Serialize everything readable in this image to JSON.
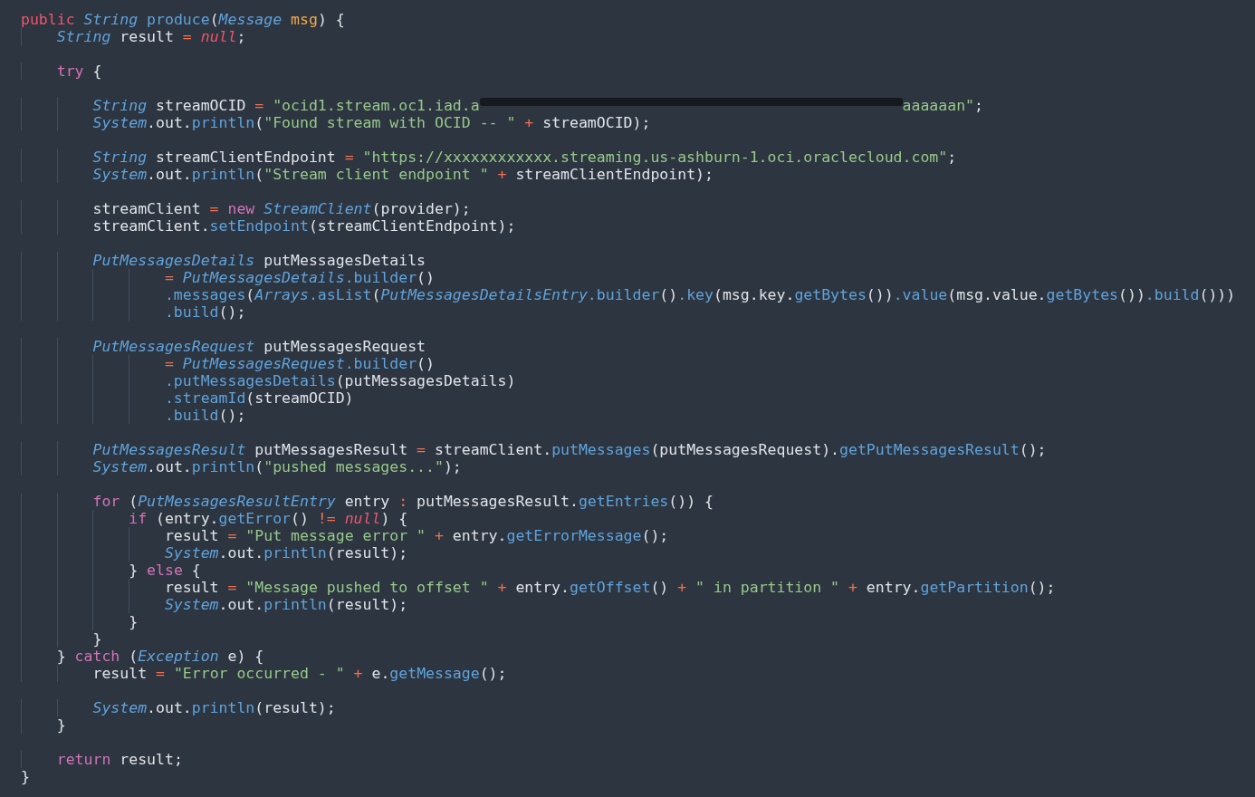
{
  "editor": {
    "lines": [
      {
        "kind": "code",
        "tokens": [
          {
            "kind": "modifier",
            "text": "public "
          },
          {
            "kind": "type",
            "text": "String "
          },
          {
            "kind": "fn",
            "text": "produce"
          },
          {
            "kind": "plain",
            "text": "("
          },
          {
            "kind": "type",
            "text": "Message "
          },
          {
            "kind": "param",
            "text": "msg"
          },
          {
            "kind": "plain",
            "text": ") {"
          }
        ]
      },
      {
        "kind": "code",
        "tokens": [
          {
            "kind": "type",
            "text": "    String"
          },
          {
            "kind": "plain",
            "text": " result "
          },
          {
            "kind": "op",
            "text": "= "
          },
          {
            "kind": "literal",
            "text": "null"
          },
          {
            "kind": "plain",
            "text": ";"
          }
        ]
      },
      {
        "kind": "blank"
      },
      {
        "kind": "code",
        "tokens": [
          {
            "kind": "keyword",
            "text": "    try"
          },
          {
            "kind": "plain",
            "text": " {"
          }
        ]
      },
      {
        "kind": "blank"
      },
      {
        "kind": "code",
        "tokens": [
          {
            "kind": "type",
            "text": "        String"
          },
          {
            "kind": "plain",
            "text": " streamOCID "
          },
          {
            "kind": "op",
            "text": "= "
          },
          {
            "kind": "str",
            "text": "\"ocid1.stream.oc1.iad.a"
          },
          {
            "kind": "redacted"
          },
          {
            "kind": "str",
            "text": "aaaaaan\""
          },
          {
            "kind": "plain",
            "text": ";"
          }
        ]
      },
      {
        "kind": "code",
        "tokens": [
          {
            "kind": "type",
            "text": "        System"
          },
          {
            "kind": "plain",
            "text": ".out."
          },
          {
            "kind": "fn",
            "text": "println"
          },
          {
            "kind": "plain",
            "text": "("
          },
          {
            "kind": "str",
            "text": "\"Found stream with OCID -- \" "
          },
          {
            "kind": "op",
            "text": "+"
          },
          {
            "kind": "plain",
            "text": " streamOCID);"
          }
        ]
      },
      {
        "kind": "blank"
      },
      {
        "kind": "code",
        "tokens": [
          {
            "kind": "type",
            "text": "        String"
          },
          {
            "kind": "plain",
            "text": " streamClientEndpoint "
          },
          {
            "kind": "op",
            "text": "= "
          },
          {
            "kind": "str",
            "text": "\"https://xxxxxxxxxxxx.streaming.us-ashburn-1.oci.oraclecloud.com\""
          },
          {
            "kind": "plain",
            "text": ";"
          }
        ]
      },
      {
        "kind": "code",
        "tokens": [
          {
            "kind": "type",
            "text": "        System"
          },
          {
            "kind": "plain",
            "text": ".out."
          },
          {
            "kind": "fn",
            "text": "println"
          },
          {
            "kind": "plain",
            "text": "("
          },
          {
            "kind": "str",
            "text": "\"Stream client endpoint \" "
          },
          {
            "kind": "op",
            "text": "+"
          },
          {
            "kind": "plain",
            "text": " streamClientEndpoint);"
          }
        ]
      },
      {
        "kind": "blank"
      },
      {
        "kind": "code",
        "tokens": [
          {
            "kind": "plain",
            "text": "        streamClient "
          },
          {
            "kind": "op",
            "text": "= "
          },
          {
            "kind": "keyword",
            "text": "new "
          },
          {
            "kind": "type",
            "text": "StreamClient"
          },
          {
            "kind": "plain",
            "text": "(provider);"
          }
        ]
      },
      {
        "kind": "code",
        "tokens": [
          {
            "kind": "plain",
            "text": "        streamClient."
          },
          {
            "kind": "fn",
            "text": "setEndpoint"
          },
          {
            "kind": "plain",
            "text": "(streamClientEndpoint);"
          }
        ]
      },
      {
        "kind": "blank"
      },
      {
        "kind": "code",
        "tokens": [
          {
            "kind": "type",
            "text": "        PutMessagesDetails"
          },
          {
            "kind": "plain",
            "text": " putMessagesDetails"
          }
        ]
      },
      {
        "kind": "code",
        "tokens": [
          {
            "kind": "op",
            "text": "                = "
          },
          {
            "kind": "type",
            "text": "PutMessagesDetails"
          },
          {
            "kind": "fn",
            "text": ".builder"
          },
          {
            "kind": "plain",
            "text": "()"
          }
        ]
      },
      {
        "kind": "code",
        "tokens": [
          {
            "kind": "fn",
            "text": "                .messages"
          },
          {
            "kind": "plain",
            "text": "("
          },
          {
            "kind": "type",
            "text": "Arrays"
          },
          {
            "kind": "fn",
            "text": ".asList"
          },
          {
            "kind": "plain",
            "text": "("
          },
          {
            "kind": "type",
            "text": "PutMessagesDetailsEntry"
          },
          {
            "kind": "fn",
            "text": ".builder"
          },
          {
            "kind": "plain",
            "text": "()"
          },
          {
            "kind": "fn",
            "text": ".key"
          },
          {
            "kind": "plain",
            "text": "(msg.key."
          },
          {
            "kind": "fn",
            "text": "getBytes"
          },
          {
            "kind": "plain",
            "text": "())"
          },
          {
            "kind": "fn",
            "text": ".value"
          },
          {
            "kind": "plain",
            "text": "(msg.value."
          },
          {
            "kind": "fn",
            "text": "getBytes"
          },
          {
            "kind": "plain",
            "text": "())"
          },
          {
            "kind": "fn",
            "text": ".build"
          },
          {
            "kind": "plain",
            "text": "()))"
          }
        ]
      },
      {
        "kind": "code",
        "tokens": [
          {
            "kind": "fn",
            "text": "                .build"
          },
          {
            "kind": "plain",
            "text": "();"
          }
        ]
      },
      {
        "kind": "blank"
      },
      {
        "kind": "code",
        "tokens": [
          {
            "kind": "type",
            "text": "        PutMessagesRequest"
          },
          {
            "kind": "plain",
            "text": " putMessagesRequest"
          }
        ]
      },
      {
        "kind": "code",
        "tokens": [
          {
            "kind": "op",
            "text": "                = "
          },
          {
            "kind": "type",
            "text": "PutMessagesRequest"
          },
          {
            "kind": "fn",
            "text": ".builder"
          },
          {
            "kind": "plain",
            "text": "()"
          }
        ]
      },
      {
        "kind": "code",
        "tokens": [
          {
            "kind": "fn",
            "text": "                .putMessagesDetails"
          },
          {
            "kind": "plain",
            "text": "(putMessagesDetails)"
          }
        ]
      },
      {
        "kind": "code",
        "tokens": [
          {
            "kind": "fn",
            "text": "                .streamId"
          },
          {
            "kind": "plain",
            "text": "(streamOCID)"
          }
        ]
      },
      {
        "kind": "code",
        "tokens": [
          {
            "kind": "fn",
            "text": "                .build"
          },
          {
            "kind": "plain",
            "text": "();"
          }
        ]
      },
      {
        "kind": "blank"
      },
      {
        "kind": "code",
        "tokens": [
          {
            "kind": "type",
            "text": "        PutMessagesResult"
          },
          {
            "kind": "plain",
            "text": " putMessagesResult "
          },
          {
            "kind": "op",
            "text": "="
          },
          {
            "kind": "plain",
            "text": " streamClient."
          },
          {
            "kind": "fn",
            "text": "putMessages"
          },
          {
            "kind": "plain",
            "text": "(putMessagesRequest)."
          },
          {
            "kind": "fn",
            "text": "getPutMessagesResult"
          },
          {
            "kind": "plain",
            "text": "();"
          }
        ]
      },
      {
        "kind": "code",
        "tokens": [
          {
            "kind": "type",
            "text": "        System"
          },
          {
            "kind": "plain",
            "text": ".out."
          },
          {
            "kind": "fn",
            "text": "println"
          },
          {
            "kind": "plain",
            "text": "("
          },
          {
            "kind": "str",
            "text": "\"pushed messages...\""
          },
          {
            "kind": "plain",
            "text": ");"
          }
        ]
      },
      {
        "kind": "blank"
      },
      {
        "kind": "code",
        "tokens": [
          {
            "kind": "keyword",
            "text": "        for"
          },
          {
            "kind": "plain",
            "text": " ("
          },
          {
            "kind": "type",
            "text": "PutMessagesResultEntry"
          },
          {
            "kind": "plain",
            "text": " entry "
          },
          {
            "kind": "op",
            "text": ":"
          },
          {
            "kind": "plain",
            "text": " putMessagesResult."
          },
          {
            "kind": "fn",
            "text": "getEntries"
          },
          {
            "kind": "plain",
            "text": "()) {"
          }
        ]
      },
      {
        "kind": "code",
        "tokens": [
          {
            "kind": "keyword",
            "text": "            if"
          },
          {
            "kind": "plain",
            "text": " (entry."
          },
          {
            "kind": "fn",
            "text": "getError"
          },
          {
            "kind": "plain",
            "text": "() "
          },
          {
            "kind": "op",
            "text": "!= "
          },
          {
            "kind": "literal",
            "text": "null"
          },
          {
            "kind": "plain",
            "text": ") {"
          }
        ]
      },
      {
        "kind": "code",
        "tokens": [
          {
            "kind": "plain",
            "text": "                result "
          },
          {
            "kind": "op",
            "text": "= "
          },
          {
            "kind": "str",
            "text": "\"Put message error \" "
          },
          {
            "kind": "op",
            "text": "+"
          },
          {
            "kind": "plain",
            "text": " entry."
          },
          {
            "kind": "fn",
            "text": "getErrorMessage"
          },
          {
            "kind": "plain",
            "text": "();"
          }
        ]
      },
      {
        "kind": "code",
        "tokens": [
          {
            "kind": "type",
            "text": "                System"
          },
          {
            "kind": "plain",
            "text": ".out."
          },
          {
            "kind": "fn",
            "text": "println"
          },
          {
            "kind": "plain",
            "text": "(result);"
          }
        ]
      },
      {
        "kind": "code",
        "tokens": [
          {
            "kind": "plain",
            "text": "            } "
          },
          {
            "kind": "keyword",
            "text": "else"
          },
          {
            "kind": "plain",
            "text": " {"
          }
        ]
      },
      {
        "kind": "code",
        "tokens": [
          {
            "kind": "plain",
            "text": "                result "
          },
          {
            "kind": "op",
            "text": "= "
          },
          {
            "kind": "str",
            "text": "\"Message pushed to offset \" "
          },
          {
            "kind": "op",
            "text": "+"
          },
          {
            "kind": "plain",
            "text": " entry."
          },
          {
            "kind": "fn",
            "text": "getOffset"
          },
          {
            "kind": "plain",
            "text": "() "
          },
          {
            "kind": "op",
            "text": "+ "
          },
          {
            "kind": "str",
            "text": "\" in partition \" "
          },
          {
            "kind": "op",
            "text": "+"
          },
          {
            "kind": "plain",
            "text": " entry."
          },
          {
            "kind": "fn",
            "text": "getPartition"
          },
          {
            "kind": "plain",
            "text": "();"
          }
        ]
      },
      {
        "kind": "code",
        "tokens": [
          {
            "kind": "type",
            "text": "                System"
          },
          {
            "kind": "plain",
            "text": ".out."
          },
          {
            "kind": "fn",
            "text": "println"
          },
          {
            "kind": "plain",
            "text": "(result);"
          }
        ]
      },
      {
        "kind": "code",
        "tokens": [
          {
            "kind": "plain",
            "text": "            }"
          }
        ]
      },
      {
        "kind": "code",
        "tokens": [
          {
            "kind": "plain",
            "text": "        }"
          }
        ]
      },
      {
        "kind": "code",
        "tokens": [
          {
            "kind": "plain",
            "text": "    } "
          },
          {
            "kind": "keyword",
            "text": "catch"
          },
          {
            "kind": "plain",
            "text": " ("
          },
          {
            "kind": "type",
            "text": "Exception"
          },
          {
            "kind": "plain",
            "text": " e) {"
          }
        ]
      },
      {
        "kind": "code",
        "tokens": [
          {
            "kind": "plain",
            "text": "        result "
          },
          {
            "kind": "op",
            "text": "= "
          },
          {
            "kind": "str",
            "text": "\"Error occurred - \" "
          },
          {
            "kind": "op",
            "text": "+"
          },
          {
            "kind": "plain",
            "text": " e."
          },
          {
            "kind": "fn",
            "text": "getMessage"
          },
          {
            "kind": "plain",
            "text": "();"
          }
        ]
      },
      {
        "kind": "blank"
      },
      {
        "kind": "code",
        "tokens": [
          {
            "kind": "type",
            "text": "        System"
          },
          {
            "kind": "plain",
            "text": ".out."
          },
          {
            "kind": "fn",
            "text": "println"
          },
          {
            "kind": "plain",
            "text": "(result);"
          }
        ]
      },
      {
        "kind": "code",
        "tokens": [
          {
            "kind": "plain",
            "text": "    }"
          }
        ]
      },
      {
        "kind": "blank"
      },
      {
        "kind": "code",
        "tokens": [
          {
            "kind": "keyword",
            "text": "    return"
          },
          {
            "kind": "plain",
            "text": " result;"
          }
        ]
      },
      {
        "kind": "code",
        "tokens": [
          {
            "kind": "plain",
            "text": "}"
          }
        ]
      }
    ]
  }
}
